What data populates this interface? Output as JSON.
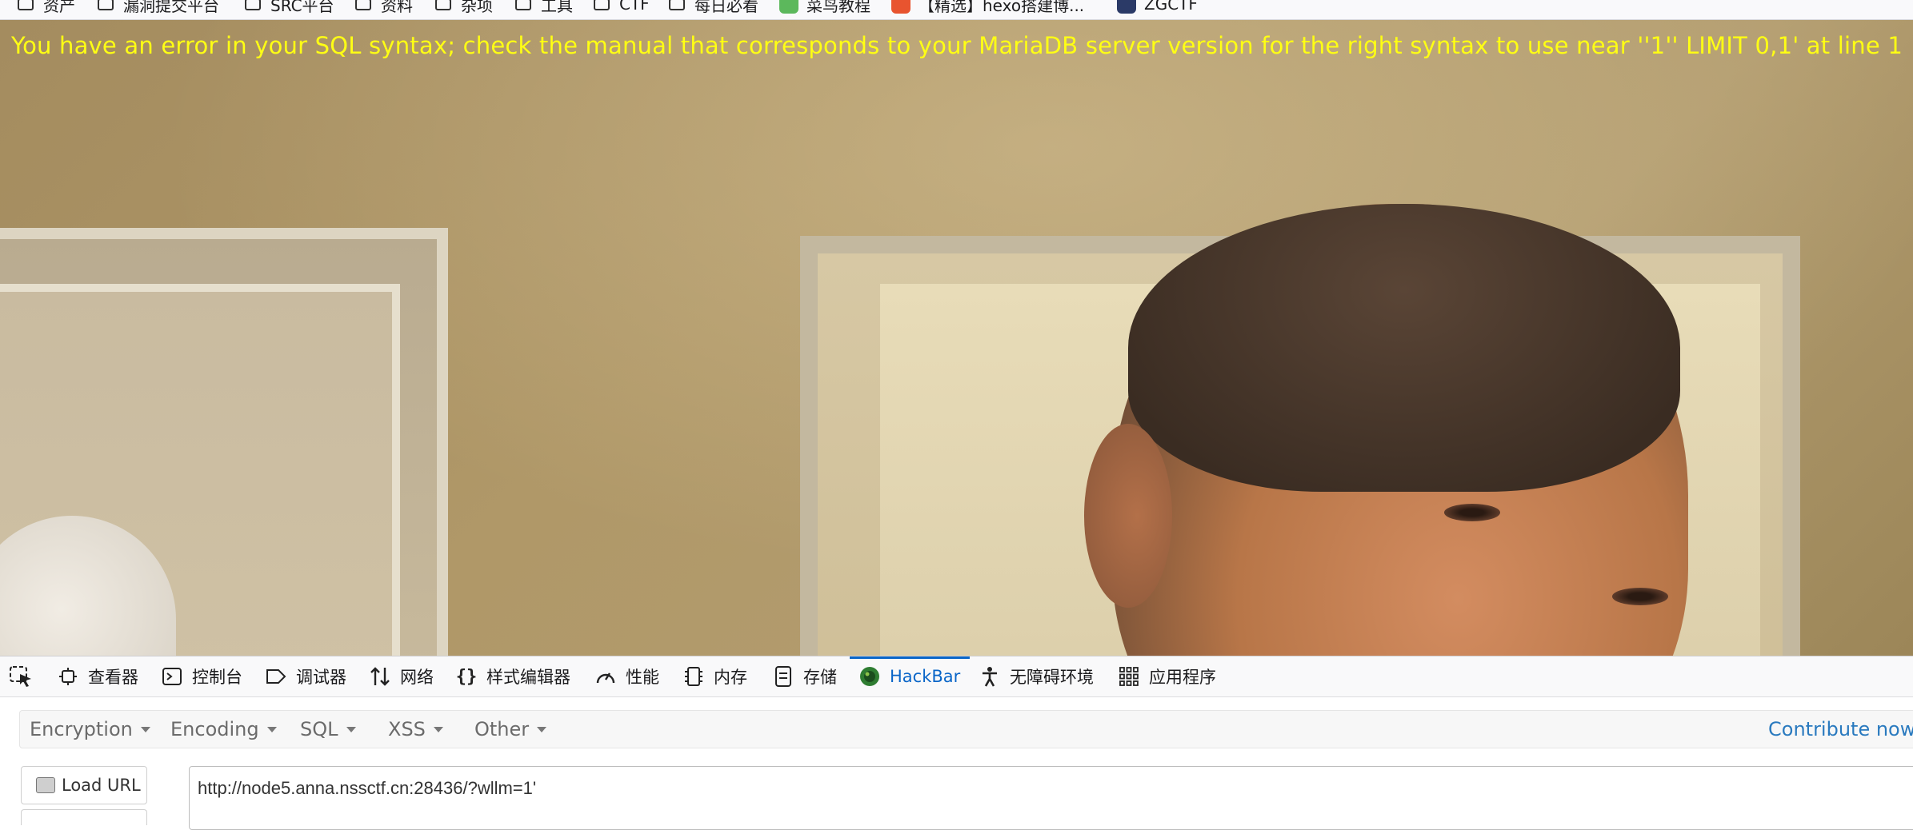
{
  "bookmarks": [
    {
      "label": "资产",
      "type": "folder"
    },
    {
      "label": "漏洞提交平台",
      "type": "folder"
    },
    {
      "label": "SRC平台",
      "type": "folder"
    },
    {
      "label": "资料",
      "type": "folder"
    },
    {
      "label": "杂项",
      "type": "folder"
    },
    {
      "label": "工具",
      "type": "folder"
    },
    {
      "label": "CTF",
      "type": "folder"
    },
    {
      "label": "每日必看",
      "type": "folder"
    },
    {
      "label": "菜鸟教程",
      "type": "site",
      "color": "#5cb85c"
    },
    {
      "label": "【精选】hexo搭建博...",
      "type": "site",
      "color": "#e8542f"
    },
    {
      "label": "ZGCTF",
      "type": "site",
      "color": "#2b3a67"
    }
  ],
  "page": {
    "error_message": "You have an error in your SQL syntax; check the manual that corresponds to your MariaDB server version for the right syntax to use near ''1'' LIMIT 0,1' at line 1",
    "error_color": "#ffff14"
  },
  "devtools": {
    "tabs": [
      {
        "label": "查看器",
        "icon": "inspector-icon"
      },
      {
        "label": "控制台",
        "icon": "console-icon"
      },
      {
        "label": "调试器",
        "icon": "debugger-icon"
      },
      {
        "label": "网络",
        "icon": "network-icon"
      },
      {
        "label": "样式编辑器",
        "icon": "style-editor-icon"
      },
      {
        "label": "性能",
        "icon": "performance-icon"
      },
      {
        "label": "内存",
        "icon": "memory-icon"
      },
      {
        "label": "存储",
        "icon": "storage-icon"
      },
      {
        "label": "HackBar",
        "icon": "hackbar-icon",
        "active": true
      },
      {
        "label": "无障碍环境",
        "icon": "accessibility-icon"
      },
      {
        "label": "应用程序",
        "icon": "application-icon"
      }
    ],
    "active_color": "#0a66c8"
  },
  "hackbar": {
    "menus": [
      "Encryption",
      "Encoding",
      "SQL",
      "XSS",
      "Other"
    ],
    "contribute": "Contribute now! Ha",
    "load_url_label": "Load URL",
    "url_value": "http://node5.anna.nssctf.cn:28436/?wllm=1'"
  }
}
